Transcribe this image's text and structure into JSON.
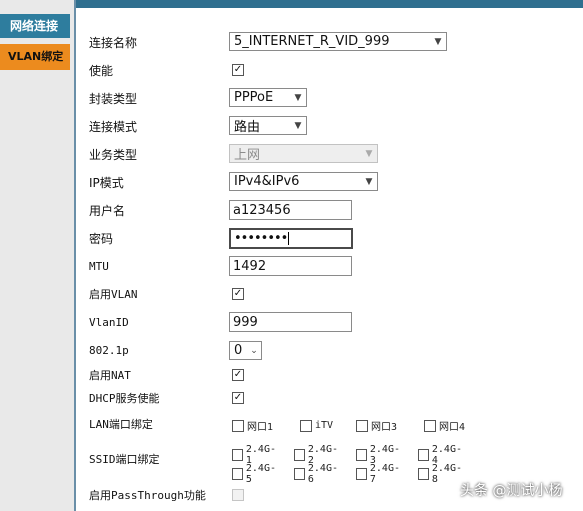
{
  "sidebar": {
    "tabs": [
      {
        "label": "网络连接"
      },
      {
        "label": "VLAN绑定"
      }
    ]
  },
  "form": {
    "conn_name": {
      "label": "连接名称",
      "value": "5_INTERNET_R_VID_999"
    },
    "enable": {
      "label": "使能",
      "checked": true
    },
    "encap": {
      "label": "封装类型",
      "value": "PPPoE"
    },
    "conn_mode": {
      "label": "连接模式",
      "value": "路由"
    },
    "service": {
      "label": "业务类型",
      "value": "上网",
      "disabled": true
    },
    "ip_mode": {
      "label": "IP模式",
      "value": "IPv4&IPv6"
    },
    "username": {
      "label": "用户名",
      "value": "a123456"
    },
    "password": {
      "label": "密码",
      "value": "••••••••"
    },
    "mtu": {
      "label": "MTU",
      "value": "1492"
    },
    "vlan_enable": {
      "label": "启用VLAN",
      "checked": true
    },
    "vlan_id": {
      "label": "VlanID",
      "value": "999"
    },
    "dot1p": {
      "label": "802.1p",
      "value": "0"
    },
    "nat": {
      "label": "启用NAT",
      "checked": true
    },
    "dhcp": {
      "label": "DHCP服务使能",
      "checked": true
    },
    "lan_bind": {
      "label": "LAN端口绑定",
      "options": [
        "网口1",
        "iTV",
        "网口3",
        "网口4"
      ]
    },
    "ssid_bind": {
      "label": "SSID端口绑定",
      "options_row1": [
        "2.4G-1",
        "2.4G-2",
        "2.4G-3",
        "2.4G-4"
      ],
      "options_row2": [
        "2.4G-5",
        "2.4G-6",
        "2.4G-7",
        "2.4G-8"
      ]
    },
    "passthrough": {
      "label": "启用PassThrough功能",
      "checked": false,
      "disabled": true
    }
  },
  "watermark": {
    "text": "头条 @测试小杨"
  }
}
